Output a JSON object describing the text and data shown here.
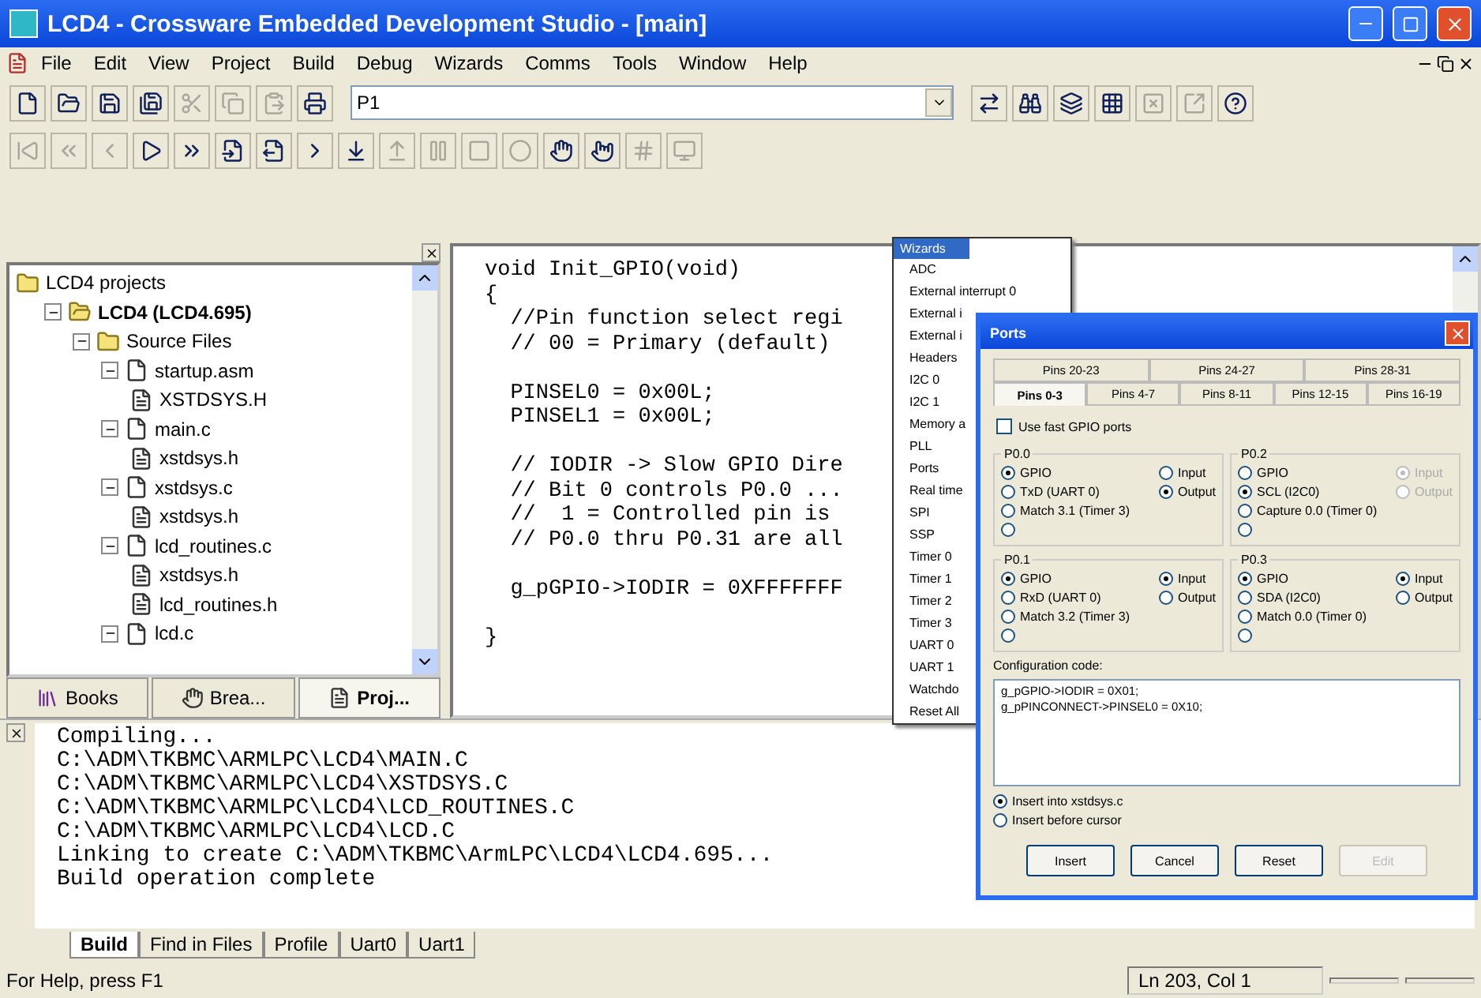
{
  "window": {
    "title": "LCD4 - Crossware Embedded Development Studio - [main]"
  },
  "menu": [
    "File",
    "Edit",
    "View",
    "Project",
    "Build",
    "Debug",
    "Wizards",
    "Comms",
    "Tools",
    "Window",
    "Help"
  ],
  "toolbar": [
    {
      "kind": "new",
      "disabled": false
    },
    {
      "kind": "open",
      "disabled": false
    },
    {
      "kind": "save",
      "disabled": false
    },
    {
      "kind": "save-all",
      "disabled": false
    },
    {
      "kind": "cut",
      "disabled": true
    },
    {
      "kind": "copy",
      "disabled": true
    },
    {
      "kind": "paste",
      "disabled": true
    },
    {
      "kind": "print",
      "disabled": false
    },
    {
      "kind": "combo",
      "value": "P1"
    },
    {
      "kind": "arrows",
      "disabled": false
    },
    {
      "kind": "binoculars",
      "disabled": false
    },
    {
      "kind": "layers",
      "disabled": false
    },
    {
      "kind": "grid",
      "disabled": false
    },
    {
      "kind": "grid-x",
      "disabled": true
    },
    {
      "kind": "export",
      "disabled": true
    },
    {
      "kind": "help",
      "disabled": false
    }
  ],
  "debug_toolbar": [
    {
      "kind": "first",
      "disabled": true
    },
    {
      "kind": "rewind",
      "disabled": true
    },
    {
      "kind": "back",
      "disabled": true
    },
    {
      "kind": "play",
      "disabled": false
    },
    {
      "kind": "forward",
      "disabled": false
    },
    {
      "kind": "step-in",
      "disabled": false
    },
    {
      "kind": "step-out",
      "disabled": false
    },
    {
      "kind": "run",
      "disabled": false
    },
    {
      "kind": "down",
      "disabled": false
    },
    {
      "kind": "up",
      "disabled": true
    },
    {
      "kind": "pause",
      "disabled": true
    },
    {
      "kind": "stop",
      "disabled": true
    },
    {
      "kind": "record",
      "disabled": true
    },
    {
      "kind": "hand",
      "disabled": false
    },
    {
      "kind": "hand-off",
      "disabled": false
    },
    {
      "kind": "counter",
      "disabled": true
    },
    {
      "kind": "monitor",
      "disabled": true
    }
  ],
  "project_tree": [
    {
      "kind": "folder",
      "label": "LCD4 projects",
      "children": [
        {
          "kind": "project",
          "label": "LCD4 (LCD4.695)",
          "expanded": true,
          "children": [
            {
              "kind": "folder",
              "label": "Source Files",
              "expanded": true,
              "children": [
                {
                  "kind": "file",
                  "label": "startup.asm",
                  "expanded": true,
                  "children": [
                    {
                      "kind": "header",
                      "label": "XSTDSYS.H"
                    }
                  ]
                },
                {
                  "kind": "file",
                  "label": "main.c",
                  "expanded": true,
                  "children": [
                    {
                      "kind": "header",
                      "label": "xstdsys.h"
                    }
                  ]
                },
                {
                  "kind": "file",
                  "label": "xstdsys.c",
                  "expanded": true,
                  "children": [
                    {
                      "kind": "header",
                      "label": "xstdsys.h"
                    }
                  ]
                },
                {
                  "kind": "file",
                  "label": "lcd_routines.c",
                  "expanded": true,
                  "children": [
                    {
                      "kind": "header",
                      "label": "xstdsys.h"
                    },
                    {
                      "kind": "header",
                      "label": "lcd_routines.h"
                    }
                  ]
                },
                {
                  "kind": "file",
                  "label": "lcd.c",
                  "expanded": true
                }
              ]
            }
          ]
        }
      ]
    }
  ],
  "panel_tabs": [
    {
      "kind": "books",
      "label": "Books",
      "selected": false
    },
    {
      "kind": "hand",
      "label": "Brea...",
      "selected": false
    },
    {
      "kind": "doc",
      "label": "Proj...",
      "selected": true
    }
  ],
  "editor_blocks": [
    [
      "void Init_GPIO(void)",
      "{",
      "  //Pin function select regi",
      "  // 00 = Primary (default)"
    ],
    [
      "  PINSEL0 = 0x00L;",
      "  PINSEL1 = 0x00L;"
    ],
    [
      "  // IODIR -> Slow GPIO Dire",
      "  // Bit 0 controls P0.0 ...",
      "  //  1 = Controlled pin is",
      "  // P0.0 thru P0.31 are all"
    ],
    [
      "  g_pGPIO->IODIR = 0XFFFFFFF"
    ],
    [
      "}"
    ]
  ],
  "wizards_menu": {
    "title": "Wizards",
    "items": [
      {
        "label": "ADC",
        "selected": false
      },
      {
        "label": "External interrupt 0",
        "selected": false
      },
      {
        "label": "External i",
        "selected": false
      },
      {
        "label": "External i",
        "selected": false
      },
      {
        "label": "Headers",
        "selected": false
      },
      {
        "label": "I2C 0",
        "selected": false
      },
      {
        "label": "I2C 1",
        "selected": false
      },
      {
        "label": "Memory a",
        "selected": false
      },
      {
        "label": "PLL",
        "selected": false
      },
      {
        "label": "Ports",
        "selected": false
      },
      {
        "label": "Real time",
        "selected": false
      },
      {
        "label": "SPI",
        "selected": false
      },
      {
        "label": "SSP",
        "selected": false
      },
      {
        "label": "Timer 0",
        "selected": false
      },
      {
        "label": "Timer 1",
        "selected": false
      },
      {
        "label": "Timer 2",
        "selected": false
      },
      {
        "label": "Timer 3",
        "selected": false
      },
      {
        "label": "UART 0",
        "selected": false
      },
      {
        "label": "UART 1",
        "selected": false
      },
      {
        "label": "Watchdo",
        "selected": false
      },
      {
        "label": "Reset All",
        "selected": false
      }
    ]
  },
  "ports_dialog": {
    "title": "Ports",
    "tab_rows": [
      [
        {
          "label": "Pins 20-23",
          "selected": false
        },
        {
          "label": "Pins 24-27",
          "selected": false
        },
        {
          "label": "Pins 28-31",
          "selected": false
        }
      ],
      [
        {
          "label": "Pins 0-3",
          "selected": true
        },
        {
          "label": "Pins 4-7",
          "selected": false
        },
        {
          "label": "Pins 8-11",
          "selected": false
        },
        {
          "label": "Pins 12-15",
          "selected": false
        },
        {
          "label": "Pins 16-19",
          "selected": false
        }
      ]
    ],
    "fast_gpio": {
      "label": "Use fast GPIO ports",
      "checked": false
    },
    "pins": [
      {
        "title": "P0.0",
        "functions": [
          {
            "label": "GPIO",
            "selected": true
          },
          {
            "label": "TxD (UART 0)",
            "selected": false
          },
          {
            "label": "Match 3.1 (Timer 3)",
            "selected": false
          },
          {
            "selected": false
          }
        ],
        "directions": [
          {
            "label": "Input",
            "selected": false,
            "disabled": false
          },
          {
            "label": "Output",
            "selected": true,
            "disabled": false
          }
        ]
      },
      {
        "title": "P0.2",
        "functions": [
          {
            "label": "GPIO",
            "selected": false
          },
          {
            "label": "SCL (I2C0)",
            "selected": true
          },
          {
            "label": "Capture 0.0 (Timer 0)",
            "selected": false
          },
          {
            "selected": false
          }
        ],
        "directions": [
          {
            "label": "Input",
            "selected": true,
            "disabled": true
          },
          {
            "label": "Output",
            "selected": false,
            "disabled": true
          }
        ]
      },
      {
        "title": "P0.1",
        "functions": [
          {
            "label": "GPIO",
            "selected": true
          },
          {
            "label": "RxD (UART 0)",
            "selected": false
          },
          {
            "label": "Match 3.2 (Timer 3)",
            "selected": false
          },
          {
            "selected": false
          }
        ],
        "directions": [
          {
            "label": "Input",
            "selected": true,
            "disabled": false
          },
          {
            "label": "Output",
            "selected": false,
            "disabled": false
          }
        ]
      },
      {
        "title": "P0.3",
        "functions": [
          {
            "label": "GPIO",
            "selected": true
          },
          {
            "label": "SDA (I2C0)",
            "selected": false
          },
          {
            "label": "Match 0.0 (Timer 0)",
            "selected": false
          },
          {
            "selected": false
          }
        ],
        "directions": [
          {
            "label": "Input",
            "selected": true,
            "disabled": false
          },
          {
            "label": "Output",
            "selected": false,
            "disabled": false
          }
        ]
      }
    ],
    "config_label": "Configuration code:",
    "config_code": [
      "g_pGPIO->IODIR = 0X01;",
      "g_pPINCONNECT->PINSEL0 = 0X10;"
    ],
    "insert_options": [
      {
        "label": "Insert into xstdsys.c",
        "selected": true
      },
      {
        "label": "Insert before cursor",
        "selected": false
      }
    ],
    "buttons": [
      {
        "label": "Insert",
        "disabled": false
      },
      {
        "label": "Cancel",
        "disabled": false
      },
      {
        "label": "Reset",
        "disabled": false
      },
      {
        "label": "Edit",
        "disabled": true
      }
    ]
  },
  "output_lines": [
    "Compiling...",
    "C:\\ADM\\TKBMC\\ARMLPC\\LCD4\\MAIN.C",
    "C:\\ADM\\TKBMC\\ARMLPC\\LCD4\\XSTDSYS.C",
    "C:\\ADM\\TKBMC\\ARMLPC\\LCD4\\LCD_ROUTINES.C",
    "C:\\ADM\\TKBMC\\ARMLPC\\LCD4\\LCD.C",
    "Linking to create C:\\ADM\\TKBMC\\ArmLPC\\LCD4\\LCD4.695...",
    "Build operation complete"
  ],
  "output_tabs": [
    {
      "label": "Build",
      "selected": true
    },
    {
      "label": "Find in Files",
      "selected": false
    },
    {
      "label": "Profile",
      "selected": false
    },
    {
      "label": "Uart0",
      "selected": false
    },
    {
      "label": "Uart1",
      "selected": false
    }
  ],
  "status_bar": {
    "message": "For Help, press F1",
    "position": "Ln 203, Col 1"
  }
}
